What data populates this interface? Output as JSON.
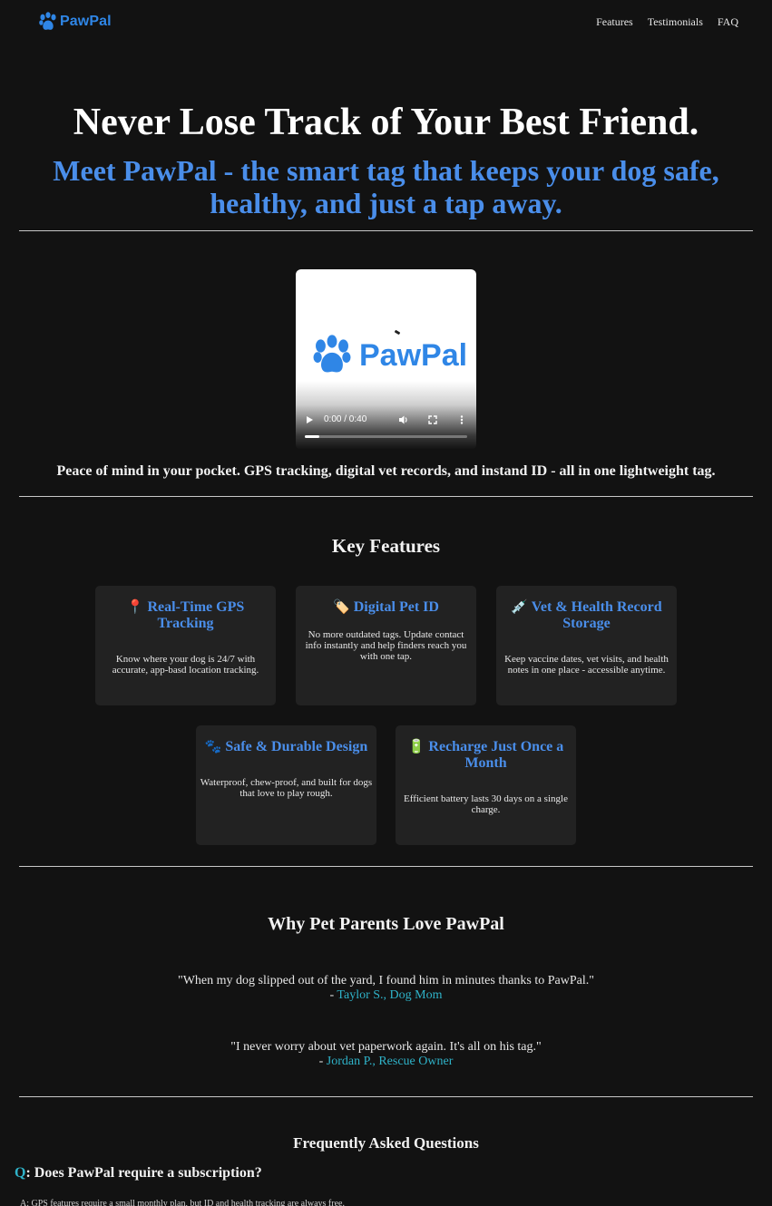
{
  "brand": {
    "name": "PawPal",
    "color": "#2f86e6",
    "icon": "paw-icon"
  },
  "nav": {
    "items": [
      "Features",
      "Testimonials",
      "FAQ"
    ]
  },
  "hero": {
    "title": "Never Lose Track of Your Best Friend.",
    "subtitle": "Meet PawPal - the smart tag that keeps your dog safe, healthy, and just a tap away."
  },
  "video": {
    "logo_text": "PawPal",
    "time": "0:00 / 0:40",
    "progress_fraction": 0.09,
    "controls": [
      "play-icon",
      "volume-icon",
      "fullscreen-icon",
      "more-options-icon"
    ]
  },
  "tagline": "Peace of mind in your pocket. GPS tracking, digital vet records, and instand ID - all in one lightweight tag.",
  "features": {
    "heading": "Key Features",
    "items": [
      {
        "emoji": "📍",
        "title": "Real-Time GPS Tracking",
        "text": "Know where your dog is 24/7 with accurate, app-basd location tracking."
      },
      {
        "emoji": "🏷️",
        "title": "Digital Pet ID",
        "text": "No more outdated tags. Update contact info instantly and help finders reach you with one tap."
      },
      {
        "emoji": "💉",
        "title": "Vet & Health Record Storage",
        "text": "Keep vaccine dates, vet visits, and health notes in one place - accessible anytime."
      },
      {
        "emoji": "🐾",
        "title": "Safe & Durable Design",
        "text": "Waterproof, chew-proof, and built for dogs that love to play rough."
      },
      {
        "emoji": "🔋",
        "title": "Recharge Just Once a Month",
        "text": "Efficient battery lasts 30 days on a single charge."
      }
    ]
  },
  "testimonials": {
    "heading": "Why Pet Parents Love PawPal",
    "items": [
      {
        "quote": "\"When my dog slipped out of the yard, I found him in minutes thanks to PawPal.\"",
        "dash": "- ",
        "author": "Taylor S., Dog Mom"
      },
      {
        "quote": "\"I never worry about vet paperwork again. It's all on his tag.\"",
        "dash": "- ",
        "author": "Jordan P., Rescue Owner"
      }
    ]
  },
  "faq": {
    "heading": "Frequently Asked Questions",
    "q_mark": "Q",
    "question": ": Does PawPal require a subscription?",
    "answer": "A: GPS features require a small monthly plan, but ID and health tracking are always free."
  },
  "colors": {
    "background": "#121212",
    "accent_blue": "#4a8eea",
    "accent_teal": "#2fb3c9",
    "card": "#222222"
  }
}
